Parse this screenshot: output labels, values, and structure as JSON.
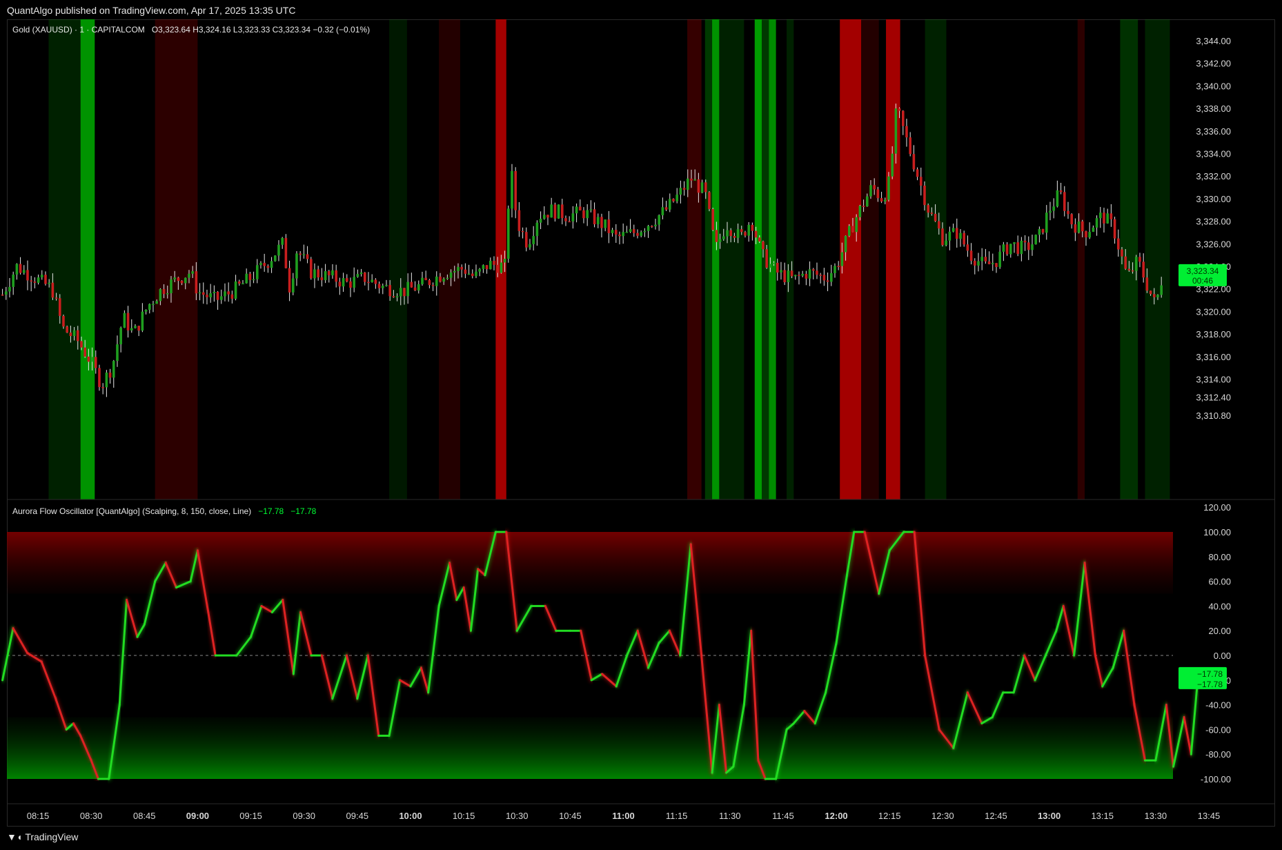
{
  "header": {
    "publisher": "QuantAlgo published on TradingView.com, Apr 17, 2025 13:35 UTC"
  },
  "price_legend": {
    "symbol": "Gold (XAUUSD) · 1 · CAPITALCOM",
    "ohlc": "O3,323.64  H3,324.16  L3,323.33  C3,323.34  −0.32 (−0.01%)"
  },
  "osc_legend": {
    "name": "Aurora Flow Oscillator [QuantAlgo] (Scalping, 8, 150, close, Line)",
    "v1": "−17.78",
    "v2": "−17.78"
  },
  "price_tag": {
    "price": "3,323.34",
    "countdown": "00:46"
  },
  "osc_tag": {
    "v1": "−17.78",
    "v2": "−17.78"
  },
  "footer": {
    "brand": "TradingView",
    "icon": "tradingview-logo-icon"
  },
  "colors": {
    "bull": "#1f9e1f",
    "bear": "#c81e1e",
    "osc_bull": "#22dd22",
    "osc_bear": "#dd2222",
    "tag": "#00ee33"
  },
  "chart_data": [
    {
      "type": "candlestick",
      "title": "Gold (XAUUSD) · 1 · CAPITALCOM",
      "y_ticks": [
        "3,344.00",
        "3,342.00",
        "3,340.00",
        "3,338.00",
        "3,336.00",
        "3,334.00",
        "3,332.00",
        "3,330.00",
        "3,328.00",
        "3,326.00",
        "3,324.00",
        "3,322.00",
        "3,320.00",
        "3,318.00",
        "3,316.00",
        "3,314.00",
        "3,312.40",
        "3,310.80"
      ],
      "ylim": [
        3310,
        3345.5
      ],
      "close_path": [
        [
          "08:05",
          3321.5
        ],
        [
          "08:09",
          3324.0
        ],
        [
          "08:15",
          3322.8
        ],
        [
          "08:19",
          3322.0
        ],
        [
          "08:22",
          3318.5
        ],
        [
          "08:26",
          3317.5
        ],
        [
          "08:30",
          3315.5
        ],
        [
          "08:33",
          3313.5
        ],
        [
          "08:36",
          3315.2
        ],
        [
          "08:39",
          3319.5
        ],
        [
          "08:42",
          3318.0
        ],
        [
          "08:46",
          3320.5
        ],
        [
          "08:50",
          3322.0
        ],
        [
          "08:55",
          3323.0
        ],
        [
          "08:58",
          3323.5
        ],
        [
          "09:00",
          3321.8
        ],
        [
          "09:05",
          3321.0
        ],
        [
          "09:10",
          3321.8
        ],
        [
          "09:15",
          3323.0
        ],
        [
          "09:20",
          3324.5
        ],
        [
          "09:24",
          3326.0
        ],
        [
          "09:26",
          3322.0
        ],
        [
          "09:28",
          3325.5
        ],
        [
          "09:32",
          3323.5
        ],
        [
          "09:38",
          3323.0
        ],
        [
          "09:42",
          3322.5
        ],
        [
          "09:47",
          3323.0
        ],
        [
          "09:52",
          3322.2
        ],
        [
          "09:58",
          3321.8
        ],
        [
          "10:03",
          3322.3
        ],
        [
          "10:10",
          3323.5
        ],
        [
          "10:15",
          3323.8
        ],
        [
          "10:18",
          3323.0
        ],
        [
          "10:22",
          3324.2
        ],
        [
          "10:27",
          3324.0
        ],
        [
          "10:28",
          3333.5
        ],
        [
          "10:30",
          3328.0
        ],
        [
          "10:33",
          3326.0
        ],
        [
          "10:36",
          3328.5
        ],
        [
          "10:40",
          3329.0
        ],
        [
          "10:44",
          3328.5
        ],
        [
          "10:49",
          3328.8
        ],
        [
          "10:55",
          3327.5
        ],
        [
          "10:58",
          3326.5
        ],
        [
          "11:03",
          3327.0
        ],
        [
          "11:08",
          3328.0
        ],
        [
          "11:12",
          3329.0
        ],
        [
          "11:16",
          3330.5
        ],
        [
          "11:19",
          3331.8
        ],
        [
          "11:23",
          3330.5
        ],
        [
          "11:26",
          3325.5
        ],
        [
          "11:29",
          3327.8
        ],
        [
          "11:33",
          3326.5
        ],
        [
          "11:36",
          3328.2
        ],
        [
          "11:39",
          3325.0
        ],
        [
          "11:43",
          3323.5
        ],
        [
          "11:48",
          3322.8
        ],
        [
          "11:52",
          3323.5
        ],
        [
          "11:57",
          3323.0
        ],
        [
          "12:00",
          3324.0
        ],
        [
          "12:05",
          3328.0
        ],
        [
          "12:10",
          3331.0
        ],
        [
          "12:13",
          3330.0
        ],
        [
          "12:15",
          3331.5
        ],
        [
          "12:17",
          3338.0
        ],
        [
          "12:19",
          3336.0
        ],
        [
          "12:22",
          3333.0
        ],
        [
          "12:26",
          3329.0
        ],
        [
          "12:30",
          3326.5
        ],
        [
          "12:34",
          3327.0
        ],
        [
          "12:38",
          3325.0
        ],
        [
          "12:42",
          3324.0
        ],
        [
          "12:45",
          3324.5
        ],
        [
          "12:49",
          3326.0
        ],
        [
          "12:53",
          3325.5
        ],
        [
          "12:57",
          3326.5
        ],
        [
          "13:00",
          3329.0
        ],
        [
          "13:03",
          3330.5
        ],
        [
          "13:06",
          3328.0
        ],
        [
          "13:10",
          3327.0
        ],
        [
          "13:15",
          3328.5
        ],
        [
          "13:18",
          3327.5
        ],
        [
          "13:22",
          3323.0
        ],
        [
          "13:25",
          3324.5
        ],
        [
          "13:28",
          3322.0
        ],
        [
          "13:30",
          3320.5
        ],
        [
          "13:32",
          3323.3
        ]
      ]
    },
    {
      "type": "line",
      "title": "Aurora Flow Oscillator [QuantAlgo] (Scalping, 8, 150, close, Line)",
      "y_ticks": [
        "120.00",
        "100.00",
        "80.00",
        "60.00",
        "40.00",
        "20.00",
        "0.00",
        "-20.00",
        "-40.00",
        "-60.00",
        "-80.00",
        "-100.00"
      ],
      "ylim": [
        -120,
        120
      ],
      "zero_line": 0,
      "overbought_zone": [
        50,
        100
      ],
      "oversold_zone": [
        -100,
        -50
      ],
      "series": [
        {
          "values": [
            [
              "08:05",
              -20
            ],
            [
              "08:08",
              22
            ],
            [
              "08:12",
              2
            ],
            [
              "08:16",
              -5
            ],
            [
              "08:20",
              -35
            ],
            [
              "08:23",
              -60
            ],
            [
              "08:25",
              -55
            ],
            [
              "08:27",
              -65
            ],
            [
              "08:30",
              -85
            ],
            [
              "08:32",
              -100
            ],
            [
              "08:35",
              -100
            ],
            [
              "08:38",
              -40
            ],
            [
              "08:40",
              45
            ],
            [
              "08:43",
              15
            ],
            [
              "08:45",
              25
            ],
            [
              "08:48",
              60
            ],
            [
              "08:51",
              75
            ],
            [
              "08:54",
              55
            ],
            [
              "08:58",
              60
            ],
            [
              "09:00",
              85
            ],
            [
              "09:03",
              35
            ],
            [
              "09:05",
              0
            ],
            [
              "09:08",
              0
            ],
            [
              "09:11",
              0
            ],
            [
              "09:15",
              15
            ],
            [
              "09:18",
              40
            ],
            [
              "09:21",
              35
            ],
            [
              "09:24",
              45
            ],
            [
              "09:27",
              -15
            ],
            [
              "09:29",
              35
            ],
            [
              "09:32",
              0
            ],
            [
              "09:35",
              0
            ],
            [
              "09:38",
              -35
            ],
            [
              "09:42",
              0
            ],
            [
              "09:45",
              -35
            ],
            [
              "09:48",
              0
            ],
            [
              "09:51",
              -65
            ],
            [
              "09:54",
              -65
            ],
            [
              "09:57",
              -20
            ],
            [
              "10:00",
              -25
            ],
            [
              "10:03",
              -10
            ],
            [
              "10:05",
              -30
            ],
            [
              "10:08",
              40
            ],
            [
              "10:11",
              75
            ],
            [
              "10:13",
              45
            ],
            [
              "10:15",
              55
            ],
            [
              "10:17",
              20
            ],
            [
              "10:19",
              70
            ],
            [
              "10:21",
              65
            ],
            [
              "10:24",
              100
            ],
            [
              "10:27",
              100
            ],
            [
              "10:30",
              20
            ],
            [
              "10:34",
              40
            ],
            [
              "10:38",
              40
            ],
            [
              "10:41",
              20
            ],
            [
              "10:45",
              20
            ],
            [
              "10:48",
              20
            ],
            [
              "10:51",
              -20
            ],
            [
              "10:54",
              -15
            ],
            [
              "10:58",
              -25
            ],
            [
              "11:01",
              0
            ],
            [
              "11:04",
              20
            ],
            [
              "11:07",
              -10
            ],
            [
              "11:10",
              10
            ],
            [
              "11:13",
              20
            ],
            [
              "11:16",
              0
            ],
            [
              "11:19",
              90
            ],
            [
              "11:22",
              0
            ],
            [
              "11:25",
              -95
            ],
            [
              "11:27",
              -40
            ],
            [
              "11:29",
              -95
            ],
            [
              "11:31",
              -90
            ],
            [
              "11:34",
              -40
            ],
            [
              "11:36",
              20
            ],
            [
              "11:38",
              -85
            ],
            [
              "11:40",
              -100
            ],
            [
              "11:43",
              -100
            ],
            [
              "11:46",
              -60
            ],
            [
              "11:48",
              -55
            ],
            [
              "11:51",
              -45
            ],
            [
              "11:54",
              -55
            ],
            [
              "11:57",
              -30
            ],
            [
              "12:00",
              10
            ],
            [
              "12:03",
              65
            ],
            [
              "12:05",
              100
            ],
            [
              "12:08",
              100
            ],
            [
              "12:12",
              50
            ],
            [
              "12:15",
              85
            ],
            [
              "12:19",
              100
            ],
            [
              "12:22",
              100
            ],
            [
              "12:25",
              0
            ],
            [
              "12:29",
              -60
            ],
            [
              "12:33",
              -75
            ],
            [
              "12:37",
              -30
            ],
            [
              "12:41",
              -55
            ],
            [
              "12:44",
              -50
            ],
            [
              "12:47",
              -30
            ],
            [
              "12:50",
              -30
            ],
            [
              "12:53",
              0
            ],
            [
              "12:56",
              -20
            ],
            [
              "12:59",
              0
            ],
            [
              "13:02",
              20
            ],
            [
              "13:04",
              40
            ],
            [
              "13:07",
              0
            ],
            [
              "13:10",
              75
            ],
            [
              "13:13",
              0
            ],
            [
              "13:15",
              -25
            ],
            [
              "13:18",
              -10
            ],
            [
              "13:21",
              20
            ],
            [
              "13:24",
              -40
            ],
            [
              "13:27",
              -85
            ],
            [
              "13:30",
              -85
            ],
            [
              "13:33",
              -40
            ],
            [
              "13:35",
              -90
            ],
            [
              "13:38",
              -50
            ],
            [
              "13:40",
              -80
            ],
            [
              "13:42",
              -15
            ]
          ]
        }
      ]
    }
  ],
  "x_axis": {
    "labels": [
      {
        "t": "08:15",
        "bold": false
      },
      {
        "t": "08:30",
        "bold": false
      },
      {
        "t": "08:45",
        "bold": false
      },
      {
        "t": "09:00",
        "bold": true
      },
      {
        "t": "09:15",
        "bold": false
      },
      {
        "t": "09:30",
        "bold": false
      },
      {
        "t": "09:45",
        "bold": false
      },
      {
        "t": "10:00",
        "bold": true
      },
      {
        "t": "10:15",
        "bold": false
      },
      {
        "t": "10:30",
        "bold": false
      },
      {
        "t": "10:45",
        "bold": false
      },
      {
        "t": "11:00",
        "bold": true
      },
      {
        "t": "11:15",
        "bold": false
      },
      {
        "t": "11:30",
        "bold": false
      },
      {
        "t": "11:45",
        "bold": false
      },
      {
        "t": "12:00",
        "bold": true
      },
      {
        "t": "12:15",
        "bold": false
      },
      {
        "t": "12:30",
        "bold": false
      },
      {
        "t": "12:45",
        "bold": false
      },
      {
        "t": "13:00",
        "bold": true
      },
      {
        "t": "13:15",
        "bold": false
      },
      {
        "t": "13:30",
        "bold": false
      },
      {
        "t": "13:45",
        "bold": false
      }
    ]
  },
  "background_bands": [
    {
      "from": "08:27",
      "to": "08:31",
      "color": "#00a300",
      "alpha": 0.9
    },
    {
      "from": "08:18",
      "to": "08:27",
      "color": "#00a300",
      "alpha": 0.2
    },
    {
      "from": "08:48",
      "to": "09:00",
      "color": "#b00000",
      "alpha": 0.25
    },
    {
      "from": "09:54",
      "to": "09:59",
      "color": "#00a300",
      "alpha": 0.15
    },
    {
      "from": "10:08",
      "to": "10:14",
      "color": "#b00000",
      "alpha": 0.2
    },
    {
      "from": "10:24",
      "to": "10:27",
      "color": "#c00000",
      "alpha": 0.85
    },
    {
      "from": "11:18",
      "to": "11:22",
      "color": "#b00000",
      "alpha": 0.3
    },
    {
      "from": "11:23",
      "to": "11:25",
      "color": "#00a300",
      "alpha": 0.35
    },
    {
      "from": "11:25",
      "to": "11:27",
      "color": "#00a300",
      "alpha": 0.9
    },
    {
      "from": "11:27",
      "to": "11:34",
      "color": "#00a300",
      "alpha": 0.2
    },
    {
      "from": "11:37",
      "to": "11:39",
      "color": "#00a300",
      "alpha": 0.95
    },
    {
      "from": "11:39",
      "to": "11:41",
      "color": "#00a300",
      "alpha": 0.35
    },
    {
      "from": "11:41",
      "to": "11:43",
      "color": "#00a300",
      "alpha": 0.85
    },
    {
      "from": "11:46",
      "to": "11:48",
      "color": "#00a300",
      "alpha": 0.2
    },
    {
      "from": "12:01",
      "to": "12:07",
      "color": "#c00000",
      "alpha": 0.85
    },
    {
      "from": "12:07",
      "to": "12:12",
      "color": "#b00000",
      "alpha": 0.2
    },
    {
      "from": "12:14",
      "to": "12:18",
      "color": "#c00000",
      "alpha": 0.85
    },
    {
      "from": "12:25",
      "to": "12:31",
      "color": "#00a300",
      "alpha": 0.2
    },
    {
      "from": "13:08",
      "to": "13:10",
      "color": "#b00000",
      "alpha": 0.25
    },
    {
      "from": "13:20",
      "to": "13:25",
      "color": "#00a300",
      "alpha": 0.3
    },
    {
      "from": "13:27",
      "to": "13:34",
      "color": "#00a300",
      "alpha": 0.2
    }
  ]
}
